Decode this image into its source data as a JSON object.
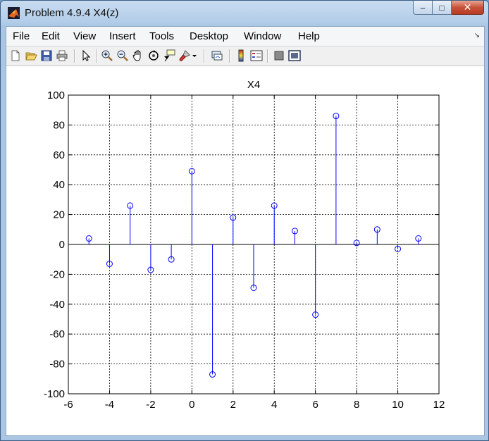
{
  "window": {
    "title": "Problem 4.9.4 X4(z)",
    "controls": {
      "minimize": "–",
      "maximize": "□",
      "close": "✕"
    }
  },
  "menu": [
    "File",
    "Edit",
    "View",
    "Insert",
    "Tools",
    "Desktop",
    "Window",
    "Help"
  ],
  "menu_overflow": "↘",
  "toolbar": [
    {
      "icon": "new-figure-icon"
    },
    {
      "icon": "open-file-icon"
    },
    {
      "icon": "save-icon"
    },
    {
      "icon": "print-icon"
    },
    {
      "icon": "edit-plot-arrow-icon"
    },
    {
      "icon": "zoom-in-icon"
    },
    {
      "icon": "zoom-out-icon"
    },
    {
      "icon": "pan-hand-icon"
    },
    {
      "icon": "rotate-3d-icon"
    },
    {
      "icon": "data-cursor-icon"
    },
    {
      "icon": "brush-icon"
    },
    {
      "icon": "brush-dropdown-icon"
    },
    {
      "icon": "link-plot-icon"
    },
    {
      "icon": "colorbar-icon"
    },
    {
      "icon": "legend-icon"
    },
    {
      "icon": "hide-plot-tools-icon"
    },
    {
      "icon": "show-plot-tools-icon"
    }
  ],
  "colors": {
    "stem": "#0000ff",
    "axes": "#000000",
    "grid": "#000000"
  },
  "chart_data": {
    "type": "stem",
    "title": "X4",
    "xlabel": "",
    "ylabel": "",
    "xlim": [
      -6,
      12
    ],
    "ylim": [
      -100,
      100
    ],
    "xticks": [
      -6,
      -4,
      -2,
      0,
      2,
      4,
      6,
      8,
      10,
      12
    ],
    "yticks": [
      -100,
      -80,
      -60,
      -40,
      -20,
      0,
      20,
      40,
      60,
      80,
      100
    ],
    "grid": "dashed",
    "series": [
      {
        "x": [
          -5,
          -4,
          -3,
          -2,
          -1,
          0,
          1,
          2,
          3,
          4,
          5,
          6,
          7,
          8,
          9,
          10,
          11
        ],
        "values": [
          4,
          -13,
          26,
          -17,
          -10,
          49,
          -87,
          18,
          -29,
          26,
          9,
          -47,
          86,
          1,
          10,
          -3,
          4
        ]
      }
    ]
  }
}
